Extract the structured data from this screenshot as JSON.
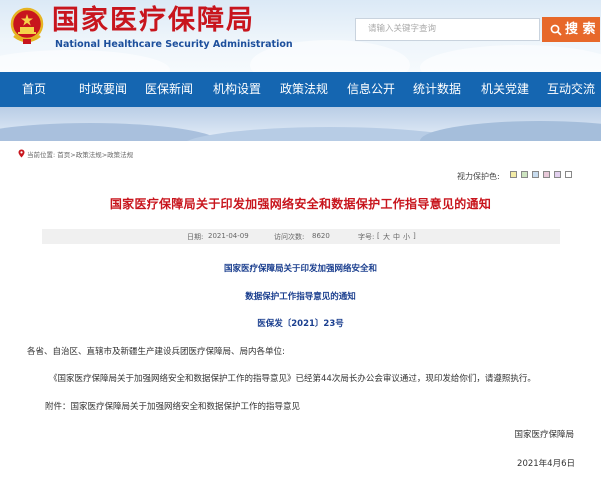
{
  "header": {
    "logo_cn": "国家医疗保障局",
    "logo_en": "National Healthcare Security Administration",
    "search_placeholder": "请输入关键字查询",
    "search_button": "搜 索"
  },
  "nav": {
    "items": [
      "首页",
      "时政要闻",
      "医保新闻",
      "机构设置",
      "政策法规",
      "信息公开",
      "统计数据",
      "机关党建",
      "互动交流"
    ]
  },
  "breadcrumb": {
    "label": "当前位置:",
    "items": [
      "首页",
      ">政策法规",
      ">政策法规"
    ]
  },
  "vision": {
    "label": "视力保护色:",
    "colors": [
      "#f3eca6",
      "#cde4c0",
      "#c8dcef",
      "#e8c9d9",
      "#e2d0ee",
      "#ffffff"
    ]
  },
  "article": {
    "title": "国家医疗保障局关于印发加强网络安全和数据保护工作指导意见的通知",
    "date_label": "日期:",
    "date": "2021-04-09",
    "visits_label": "访问次数:",
    "visits": "8620",
    "font_label": "字号:",
    "font_sizes": [
      "[",
      "大",
      "中",
      "小",
      "]"
    ],
    "doc_title_line1": "国家医疗保障局关于印发加强网络安全和",
    "doc_title_line2": "数据保护工作指导意见的通知",
    "doc_number": "医保发〔2021〕23号",
    "addressee": "各省、自治区、直辖市及新疆生产建设兵团医疗保障局、局内各单位:",
    "body": "《国家医疗保障局关于加强网络安全和数据保护工作的指导意见》已经第44次局长办公会审议通过，现印发给你们，请遵照执行。",
    "attachment": "附件：国家医疗保障局关于加强网络安全和数据保护工作的指导意见",
    "signature": "国家医疗保障局",
    "sign_date": "2021年4月6日"
  },
  "colors": {
    "brand_red": "#c8151d",
    "nav_blue": "#1566b1",
    "doc_blue": "#1b3f8f",
    "search_orange": "#e7682a"
  }
}
